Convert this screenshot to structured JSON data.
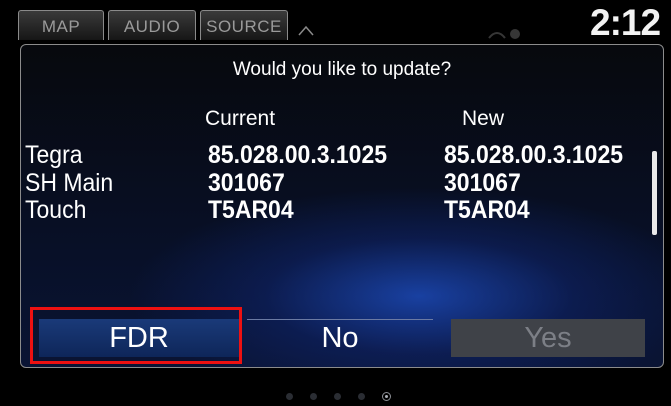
{
  "top_bar": {
    "tabs": [
      "MAP",
      "AUDIO",
      "SOURCE"
    ],
    "clock": "2:12"
  },
  "dialog": {
    "title": "Would you like to update?",
    "columns": {
      "current": "Current",
      "new": "New"
    },
    "rows": [
      {
        "name": "Tegra",
        "current": "85.028.00.3.1025",
        "new": "85.028.00.3.1025"
      },
      {
        "name": "SH Main",
        "current": "301067",
        "new": "301067"
      },
      {
        "name": "Touch",
        "current": "T5AR04",
        "new": "T5AR04"
      }
    ],
    "buttons": {
      "fdr": "FDR",
      "no": "No",
      "yes": "Yes"
    }
  },
  "page_dots": {
    "count": 5,
    "active_index": 4
  },
  "colors": {
    "highlight": "#ee1111",
    "button_selected": "#1a3a79",
    "button_disabled": "#3f4248"
  }
}
